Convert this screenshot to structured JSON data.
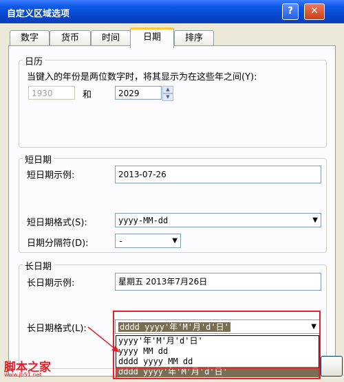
{
  "window": {
    "title": "自定义区域选项",
    "help_glyph": "?",
    "close_glyph": "✕"
  },
  "tabs": [
    {
      "label": "数字",
      "active": false
    },
    {
      "label": "货币",
      "active": false
    },
    {
      "label": "时间",
      "active": false
    },
    {
      "label": "日期",
      "active": true
    },
    {
      "label": "排序",
      "active": false
    }
  ],
  "calendar": {
    "group_label": "日历",
    "description": "当键入的年份是两位数字时，将其显示为在这些年之间(Y):",
    "from_year": "1930",
    "and_label": "和",
    "to_year": "2029",
    "spin_up": "▲",
    "spin_down": "▼"
  },
  "short_date": {
    "group_label": "短日期",
    "example_label": "短日期示例:",
    "example_value": "2013-07-26",
    "format_label": "短日期格式(S):",
    "format_value": "yyyy-MM-dd",
    "separator_label": "日期分隔符(D):",
    "separator_value": "-"
  },
  "long_date": {
    "group_label": "长日期",
    "example_label": "长日期示例:",
    "example_value": "星期五 2013年7月26日",
    "format_label": "长日期格式(L):",
    "format_value": "dddd yyyy'年'M'月'd'日'",
    "options": [
      {
        "label": "yyyy'年'M'月'd'日'",
        "highlighted": false
      },
      {
        "label": "yyyy MM dd",
        "highlighted": false
      },
      {
        "label": "dddd yyyy MM dd",
        "highlighted": false
      },
      {
        "label": "dddd yyyy'年'M'月'd'日'",
        "highlighted": true
      }
    ]
  },
  "icons": {
    "dropdown_arrow": "▼"
  },
  "watermark": {
    "text": "脚本之家",
    "url": "www.jb51.net"
  },
  "colors": {
    "annotation_red": "#e5202a",
    "selection": "#7a6e52",
    "title_blue": "#0b58e5"
  }
}
